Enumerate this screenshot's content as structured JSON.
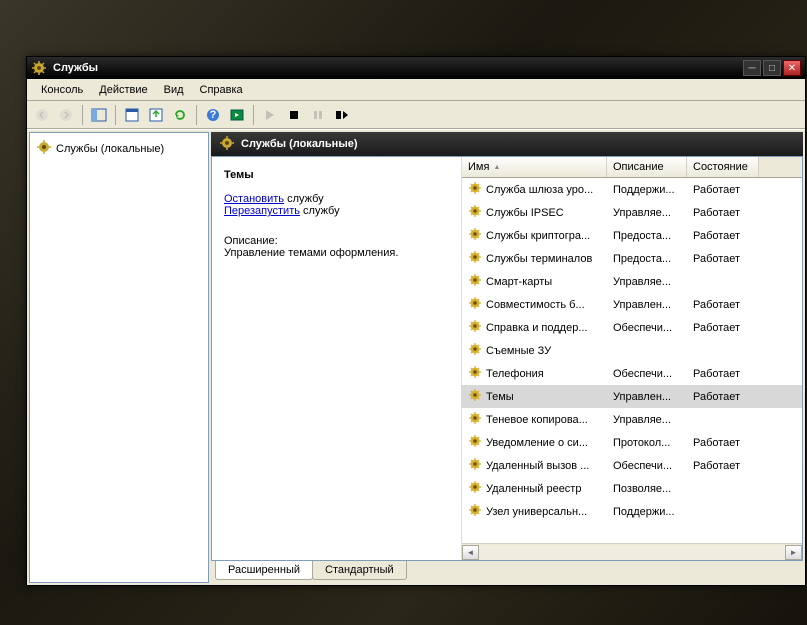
{
  "window": {
    "title": "Службы"
  },
  "menubar": [
    "Консоль",
    "Действие",
    "Вид",
    "Справка"
  ],
  "tree": {
    "root_label": "Службы (локальные)"
  },
  "panel_header": "Службы (локальные)",
  "detail": {
    "selected_name": "Темы",
    "action_stop": "Остановить",
    "action_stop_suffix": " службу",
    "action_restart": "Перезапустить",
    "action_restart_suffix": " службу",
    "desc_label": "Описание:",
    "desc_text": "Управление темами оформления."
  },
  "columns": {
    "name": "Имя",
    "desc": "Описание",
    "state": "Состояние"
  },
  "services": [
    {
      "name": "Служба шлюза уро...",
      "desc": "Поддержи...",
      "state": "Работает",
      "sel": false
    },
    {
      "name": "Службы IPSEC",
      "desc": "Управляе...",
      "state": "Работает",
      "sel": false
    },
    {
      "name": "Службы криптогра...",
      "desc": "Предоста...",
      "state": "Работает",
      "sel": false
    },
    {
      "name": "Службы терминалов",
      "desc": "Предоста...",
      "state": "Работает",
      "sel": false
    },
    {
      "name": "Смарт-карты",
      "desc": "Управляе...",
      "state": "",
      "sel": false
    },
    {
      "name": "Совместимость б...",
      "desc": "Управлен...",
      "state": "Работает",
      "sel": false
    },
    {
      "name": "Справка и поддер...",
      "desc": "Обеспечи...",
      "state": "Работает",
      "sel": false
    },
    {
      "name": "Съемные ЗУ",
      "desc": "",
      "state": "",
      "sel": false
    },
    {
      "name": "Телефония",
      "desc": "Обеспечи...",
      "state": "Работает",
      "sel": false
    },
    {
      "name": "Темы",
      "desc": "Управлен...",
      "state": "Работает",
      "sel": true
    },
    {
      "name": "Теневое копирова...",
      "desc": "Управляе...",
      "state": "",
      "sel": false
    },
    {
      "name": "Уведомление о си...",
      "desc": "Протокол...",
      "state": "Работает",
      "sel": false
    },
    {
      "name": "Удаленный вызов ...",
      "desc": "Обеспечи...",
      "state": "Работает",
      "sel": false
    },
    {
      "name": "Удаленный реестр",
      "desc": "Позволяе...",
      "state": "",
      "sel": false
    },
    {
      "name": "Узел универсальн...",
      "desc": "Поддержи...",
      "state": "",
      "sel": false
    }
  ],
  "tabs": {
    "extended": "Расширенный",
    "standard": "Стандартный"
  },
  "colors": {
    "accent": "#316ac5"
  }
}
